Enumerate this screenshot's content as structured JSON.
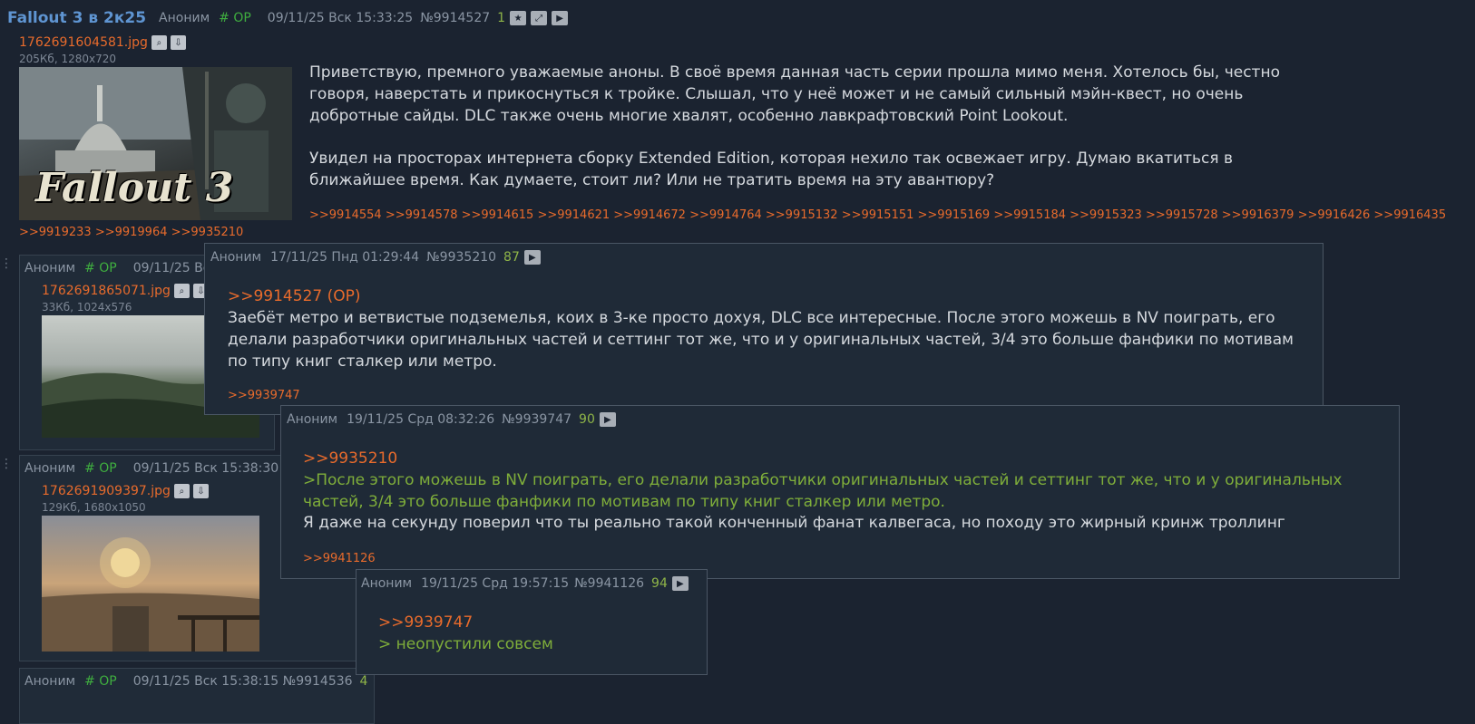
{
  "op": {
    "title": "Fallout 3 в 2к25",
    "name": "Аноним",
    "trip": "# OP",
    "date": "09/11/25 Вск 15:33:25",
    "num": "№9914527",
    "count": "1",
    "file": {
      "name": "1762691604581.jpg",
      "info": "205Кб, 1280x720",
      "logo_text": "Fallout 3"
    },
    "text": [
      "Приветствую, премного уважаемые аноны. В своё время данная часть серии прошла мимо меня. Хотелось бы, честно говоря, наверстать и прикоснуться к тройке. Слышал, что у неё может и не самый сильный мэйн-квест, но очень добротные сайды. DLC также очень многие хвалят, особенно лавкрафтовский Point Lookout.",
      "Увидел на просторах интернета сборку Extended Edition, которая нехило так освежает игру. Думаю вкатиться в ближайшее время. Как думаете, стоит ли? Или не тратить время на эту авантюру?"
    ],
    "replies_line1": ">>9914554 >>9914578 >>9914615 >>9914621 >>9914672 >>9914764 >>9915132 >>9915151 >>9915169 >>9915184 >>9915323 >>9915728 >>9916379 >>9916426 >>9916435",
    "replies_line2": ">>9919233 >>9919964 >>9935210"
  },
  "post2": {
    "name": "Аноним",
    "trip": "# OP",
    "date": "09/11/25 Вс",
    "file": {
      "name": "1762691865071.jpg",
      "info": "33Кб, 1024x576"
    }
  },
  "post3": {
    "name": "Аноним",
    "trip": "# OP",
    "date": "09/11/25 Вск 15:38:30",
    "file": {
      "name": "1762691909397.jpg",
      "info": "129Кб, 1680x1050"
    }
  },
  "post4": {
    "name": "Аноним",
    "trip": "# OP",
    "date": "09/11/25 Вск 15:38:15 №9914536",
    "count": "4"
  },
  "popup1": {
    "name": "Аноним",
    "date": "17/11/25 Пнд 01:29:44",
    "num": "№9935210",
    "count": "87",
    "reply_to": ">>9914527 (OP)",
    "text": "Заебёт метро и ветвистые подземелья, коих в 3-ке просто дохуя, DLC все интересные. После этого можешь в NV поиграть, его делали разработчики оригинальных частей и сеттинг тот же, что и у оригинальных частей, 3/4 это больше фанфики по мотивам по типу книг сталкер или метро.",
    "replies": ">>9939747"
  },
  "popup2": {
    "name": "Аноним",
    "date": "19/11/25 Срд 08:32:26",
    "num": "№9939747",
    "count": "90",
    "reply_to": ">>9935210",
    "quote": ">После этого можешь в NV поиграть, его делали разработчики оригинальных частей и сеттинг тот же, что и у оригинальных частей, 3/4 это больше фанфики по мотивам по типу книг сталкер или метро.",
    "text": "Я даже на секунду поверил что ты реально такой конченный фанат калвегаса, но походу это жирный кринж троллинг",
    "replies": ">>9941126"
  },
  "popup3": {
    "name": "Аноним",
    "date": "19/11/25 Срд 19:57:15",
    "num": "№9941126",
    "count": "94",
    "reply_to": ">>9939747",
    "quote": "> неопустили совсем"
  },
  "icons": {
    "favorite": "star-icon",
    "expand": "expand-icon",
    "play": "play-icon",
    "search": "search-icon",
    "download": "download-icon"
  },
  "colors": {
    "background": "#1b2330",
    "link": "#e86b2c",
    "title": "#5f95d2",
    "trip": "#3fae3f",
    "greentext": "#7fae3a",
    "count": "#8fb548"
  }
}
